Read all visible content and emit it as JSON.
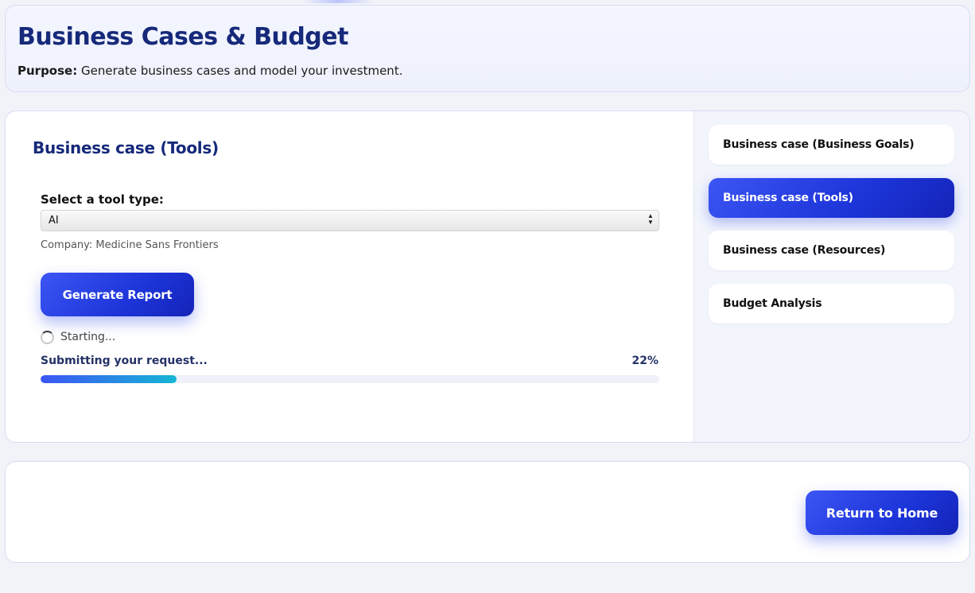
{
  "header": {
    "title": "Business Cases & Budget",
    "purpose_label": "Purpose:",
    "purpose_text": "Generate business cases and model your investment."
  },
  "main": {
    "section_title": "Business case (Tools)",
    "tool_select": {
      "label": "Select a tool type:",
      "value": "AI"
    },
    "company": "Company: Medicine Sans Frontiers",
    "generate_button": "Generate Report",
    "status": "Starting...",
    "progress": {
      "label": "Submitting your request...",
      "percent_text": "22%",
      "value": 22
    }
  },
  "sidebar": {
    "items": [
      {
        "label": "Business case (Business Goals)",
        "active": false
      },
      {
        "label": "Business case (Tools)",
        "active": true
      },
      {
        "label": "Business case (Resources)",
        "active": false
      },
      {
        "label": "Budget Analysis",
        "active": false
      }
    ]
  },
  "footer": {
    "return_button": "Return to Home"
  },
  "colors": {
    "accent": "#1c34d8",
    "title": "#16297a",
    "progress_start": "#3c55f4",
    "progress_end": "#16b5d4"
  }
}
